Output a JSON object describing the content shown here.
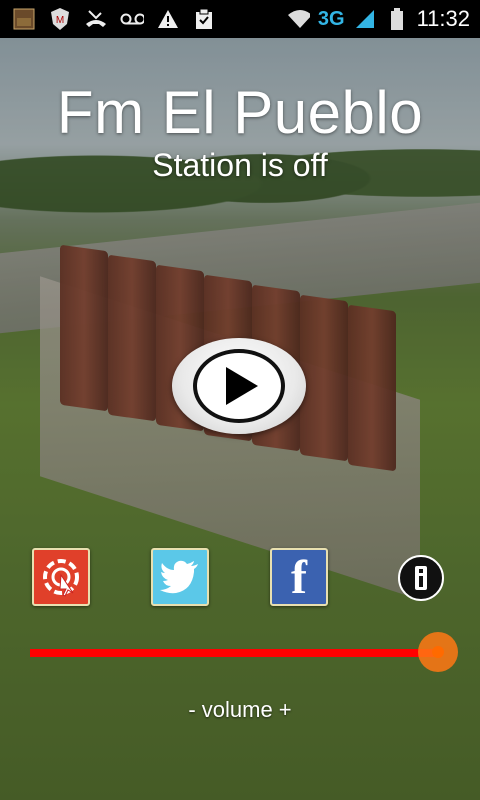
{
  "status_bar": {
    "icons": [
      "app-thumbnail-icon",
      "shield-icon",
      "missed-call-icon",
      "voicemail-icon",
      "warning-icon",
      "clipboard-icon"
    ],
    "network": "3G",
    "time": "11:32"
  },
  "station": {
    "name": "Fm El Pueblo",
    "status": "Station is off"
  },
  "controls": {
    "play_icon": "play-icon",
    "web_icon": "web-icon",
    "twitter_icon": "twitter-icon",
    "facebook_letter": "f",
    "info_icon": "info-icon"
  },
  "volume": {
    "label": "- volume +",
    "level": 1.0,
    "fill_color": "#ff0000",
    "thumb_color": "#ff7a1a"
  }
}
